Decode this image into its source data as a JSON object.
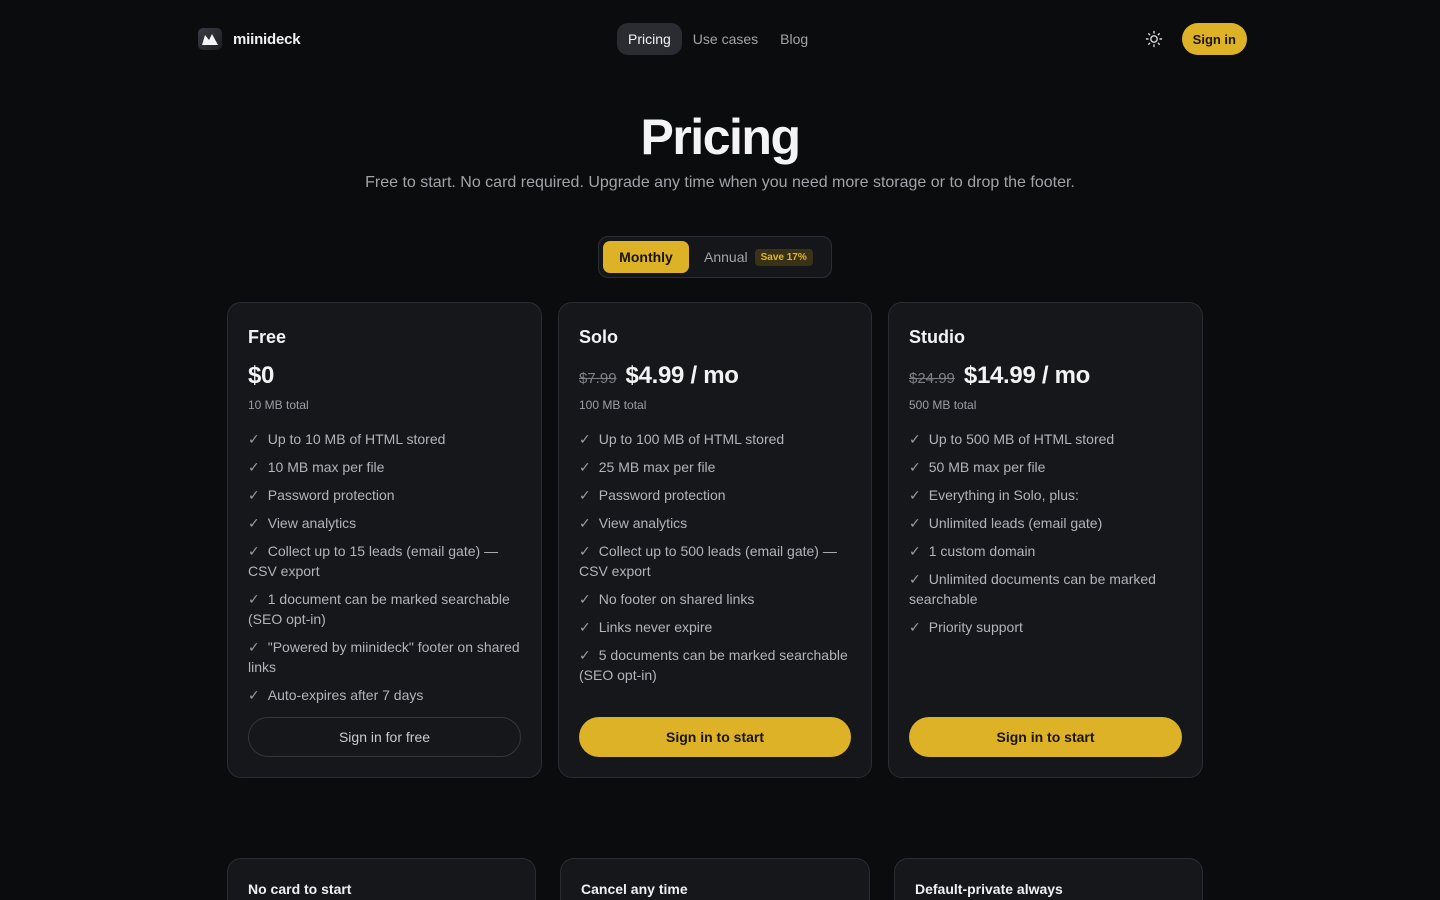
{
  "header": {
    "brand": "miinideck",
    "nav": [
      {
        "label": "Pricing",
        "active": true
      },
      {
        "label": "Use cases",
        "active": false
      },
      {
        "label": "Blog",
        "active": false
      }
    ],
    "sign_in": "Sign in"
  },
  "hero": {
    "title": "Pricing",
    "subtitle": "Free to start. No card required. Upgrade any time when you need more storage or to drop the footer."
  },
  "billing_toggle": {
    "monthly": "Monthly",
    "annual": "Annual",
    "save_badge": "Save 17%",
    "selected": "Monthly"
  },
  "plans": [
    {
      "name": "Free",
      "old_price": "",
      "price": "$0",
      "storage": "10 MB total",
      "features": [
        "Up to 10 MB of HTML stored",
        "10 MB max per file",
        "Password protection",
        "View analytics",
        "Collect up to 15 leads (email gate) — CSV export",
        "1 document can be marked searchable (SEO opt-in)",
        "\"Powered by miinideck\" footer on shared links",
        "Auto-expires after 7 days"
      ],
      "cta": "Sign in for free"
    },
    {
      "name": "Solo",
      "old_price": "$7.99",
      "price": "$4.99 / mo",
      "storage": "100 MB total",
      "features": [
        "Up to 100 MB of HTML stored",
        "25 MB max per file",
        "Password protection",
        "View analytics",
        "Collect up to 500 leads (email gate) — CSV export",
        "No footer on shared links",
        "Links never expire",
        "5 documents can be marked searchable (SEO opt-in)"
      ],
      "cta": "Sign in to start"
    },
    {
      "name": "Studio",
      "old_price": "$24.99",
      "price": "$14.99 / mo",
      "storage": "500 MB total",
      "features": [
        "Up to 500 MB of HTML stored",
        "50 MB max per file",
        "Everything in Solo, plus:",
        "Unlimited leads (email gate)",
        "1 custom domain",
        "Unlimited documents can be marked searchable",
        "Priority support"
      ],
      "cta": "Sign in to start"
    }
  ],
  "info_cards": [
    {
      "title": "No card to start"
    },
    {
      "title": "Cancel any time"
    },
    {
      "title": "Default-private always"
    }
  ],
  "colors": {
    "background": "#0b0c0e",
    "card": "#16171b",
    "accent": "#ddb226"
  },
  "icons": {
    "logo": "miinideck-logo-icon",
    "theme": "sun-icon",
    "check": "check-icon"
  }
}
